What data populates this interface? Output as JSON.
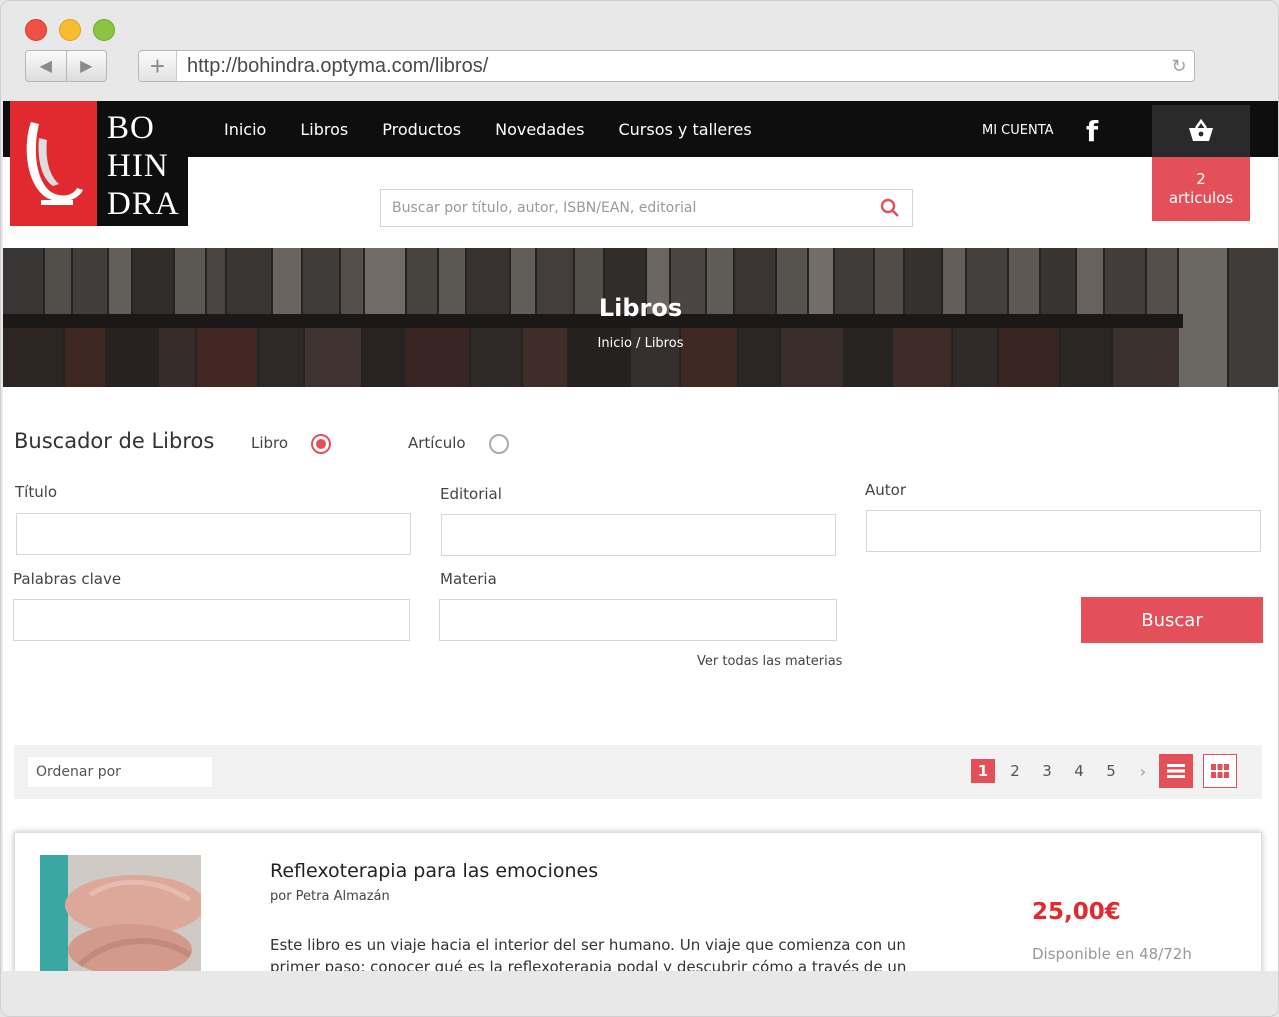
{
  "browser": {
    "url": "http://bohindra.optyma.com/libros/",
    "back_icon": "◀",
    "forward_icon": "▶",
    "new_tab_icon": "+",
    "reload_icon": "↻"
  },
  "site": {
    "logo_text_lines": [
      "BO",
      "HIN",
      "DRA"
    ],
    "menu": [
      "Inicio",
      "Libros",
      "Productos",
      "Novedades",
      "Cursos y talleres"
    ],
    "account_label": "MI CUENTA",
    "social_icon": "f",
    "cart": {
      "count": "2",
      "label": "articulos"
    },
    "search_placeholder": "Buscar por título, autor, ISBN/EAN, editorial"
  },
  "hero": {
    "title": "Libros",
    "breadcrumb": "Inicio / Libros"
  },
  "finder": {
    "title": "Buscador de Libros",
    "radio_libro": "Libro",
    "radio_articulo": "Artículo",
    "selected": "Libro",
    "fields": {
      "titulo": "Título",
      "editorial": "Editorial",
      "autor": "Autor",
      "palabras": "Palabras clave",
      "materia": "Materia"
    },
    "ver_materias": "Ver todas las materias",
    "buscar": "Buscar"
  },
  "listing": {
    "sort_label": "Ordenar por",
    "pages": [
      "1",
      "2",
      "3",
      "4",
      "5"
    ],
    "current_page": "1",
    "next_icon": "›"
  },
  "book": {
    "title": "Reflexoterapia para las emociones",
    "author": "por Petra Almazán",
    "description": "Este libro es un viaje hacia el interior del ser humano. Un viaje que comienza con un primer paso: conocer qué es la reflexoterapia podal y descubrir cómo a través de un relajante",
    "price": "25,00€",
    "availability": "Disponible en 48/72h"
  },
  "colors": {
    "accent": "#e4505a",
    "brand_red": "#e02a2f",
    "topbar": "#0e0e0e"
  }
}
